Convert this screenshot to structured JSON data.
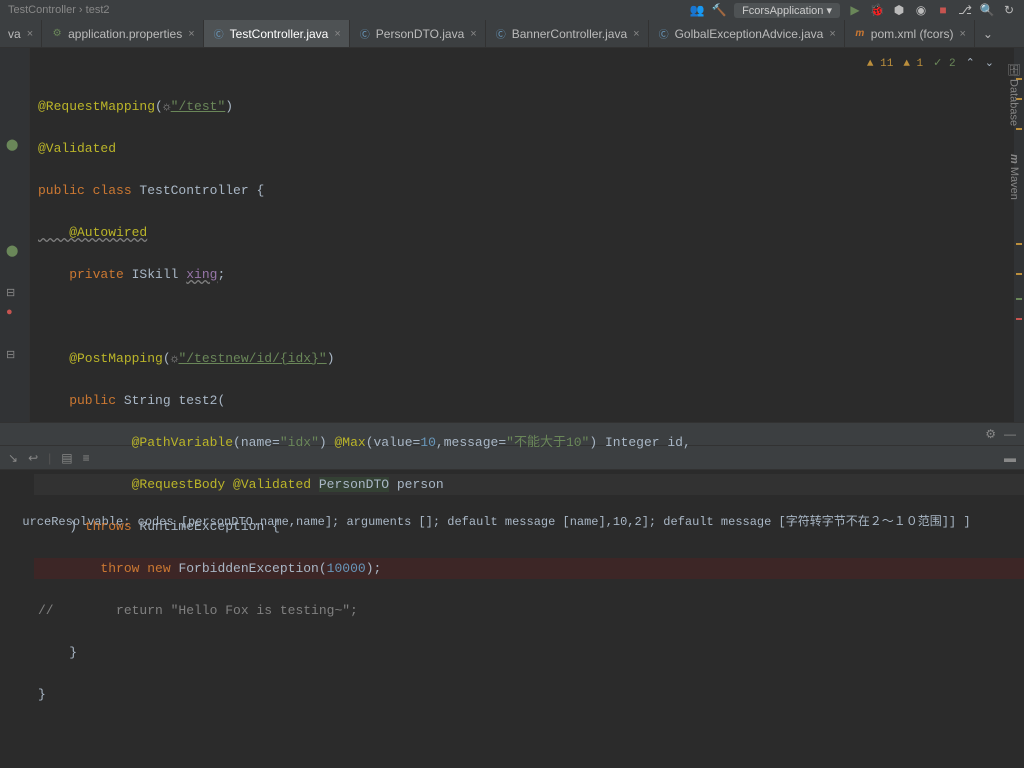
{
  "breadcrumb": {
    "part1": "TestController",
    "sep": " › ",
    "part2": "test2"
  },
  "runConfig": "FcorsApplication",
  "tabs": [
    {
      "label": "va",
      "icon": "java",
      "active": false
    },
    {
      "label": "application.properties",
      "icon": "props",
      "active": false
    },
    {
      "label": "TestController.java",
      "icon": "class",
      "active": true
    },
    {
      "label": "PersonDTO.java",
      "icon": "class",
      "active": false
    },
    {
      "label": "BannerController.java",
      "icon": "class",
      "active": false
    },
    {
      "label": "GolbalExceptionAdvice.java",
      "icon": "class",
      "active": false
    },
    {
      "label": "pom.xml (fcors)",
      "icon": "maven",
      "active": false
    }
  ],
  "indicators": {
    "warn": "11",
    "err": "1",
    "ok": "2"
  },
  "code": {
    "l1a": "@RequestMapping",
    "l1b": "(",
    "l1c": "\"/test\"",
    "l1d": ")",
    "l2": "@Validated",
    "l3a": "public class ",
    "l3b": "TestController ",
    "l3c": "{",
    "l4": "    @Autowired",
    "l5a": "    private ",
    "l5b": "ISkill ",
    "l5c": "xing",
    "l5d": ";",
    "l6": "",
    "l7a": "    @PostMapping",
    "l7b": "(",
    "l7c": "\"/testnew/id/{idx}\"",
    "l7d": ")",
    "l8a": "    public ",
    "l8b": "String ",
    "l8c": "test2",
    "l8d": "(",
    "l9a": "            @PathVariable",
    "l9b": "(name=",
    "l9c": "\"idx\"",
    "l9d": ") ",
    "l9e": "@Max",
    "l9f": "(value=",
    "l9g": "10",
    "l9h": ",message=",
    "l9i": "\"不能大于10\"",
    "l9j": ") Integer ",
    "l9k": "id",
    "l9l": ",",
    "l10a": "            @RequestBody @Validated ",
    "l10b": "PersonDTO",
    "l10c": " person",
    "l11a": "    ) ",
    "l11b": "throws ",
    "l11c": "RuntimeException ",
    "l11d": "{",
    "l12a": "        throw new ",
    "l12b": "ForbiddenException(",
    "l12c": "10000",
    "l12d": ");",
    "l13a": "//        return \"Hello Fox is testing~\";",
    "l14": "    }",
    "l15": "}"
  },
  "rightTabs": {
    "database": "Database",
    "maven": "Maven"
  },
  "console": {
    "line": "urceResolvable: codes [personDTO.name,name]; arguments []; default message [name],10,2]; default message [字符转字节不在２～１０范围]] ]"
  },
  "icons": {
    "gear": "⚙",
    "minimize": "—",
    "chevronDown": "⌄",
    "chevronUp": "⌃"
  }
}
